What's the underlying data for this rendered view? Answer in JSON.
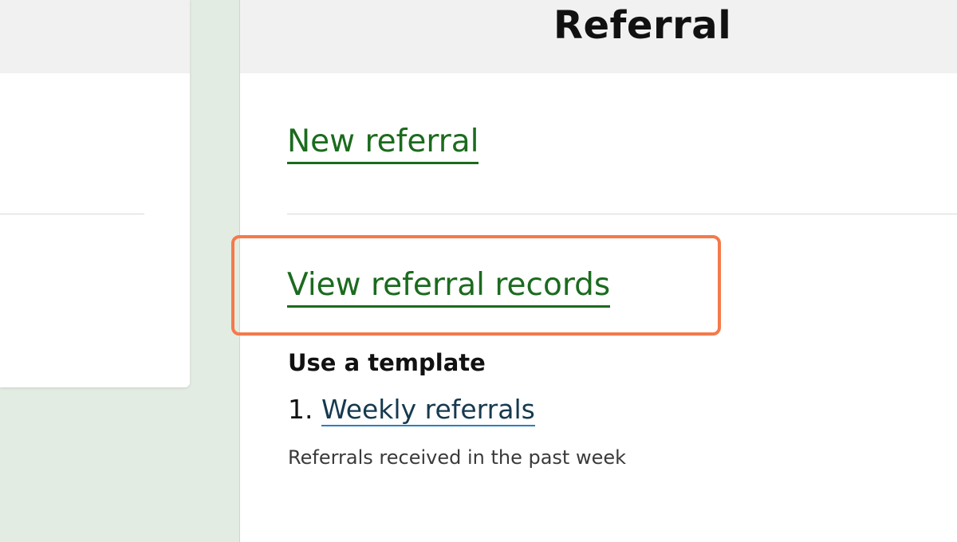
{
  "page": {
    "title": "Referral"
  },
  "links": {
    "new_referral": "New referral",
    "view_referral_records": "View referral records"
  },
  "templates": {
    "heading": "Use a template",
    "items": [
      {
        "number": "1.",
        "label": "Weekly referrals",
        "description": "Referrals received in the past week"
      }
    ]
  },
  "colors": {
    "link_green": "#1b6b1e",
    "highlight_orange": "#f47a4b",
    "background_green": "#e3ece2",
    "header_gray": "#f1f1f1"
  }
}
